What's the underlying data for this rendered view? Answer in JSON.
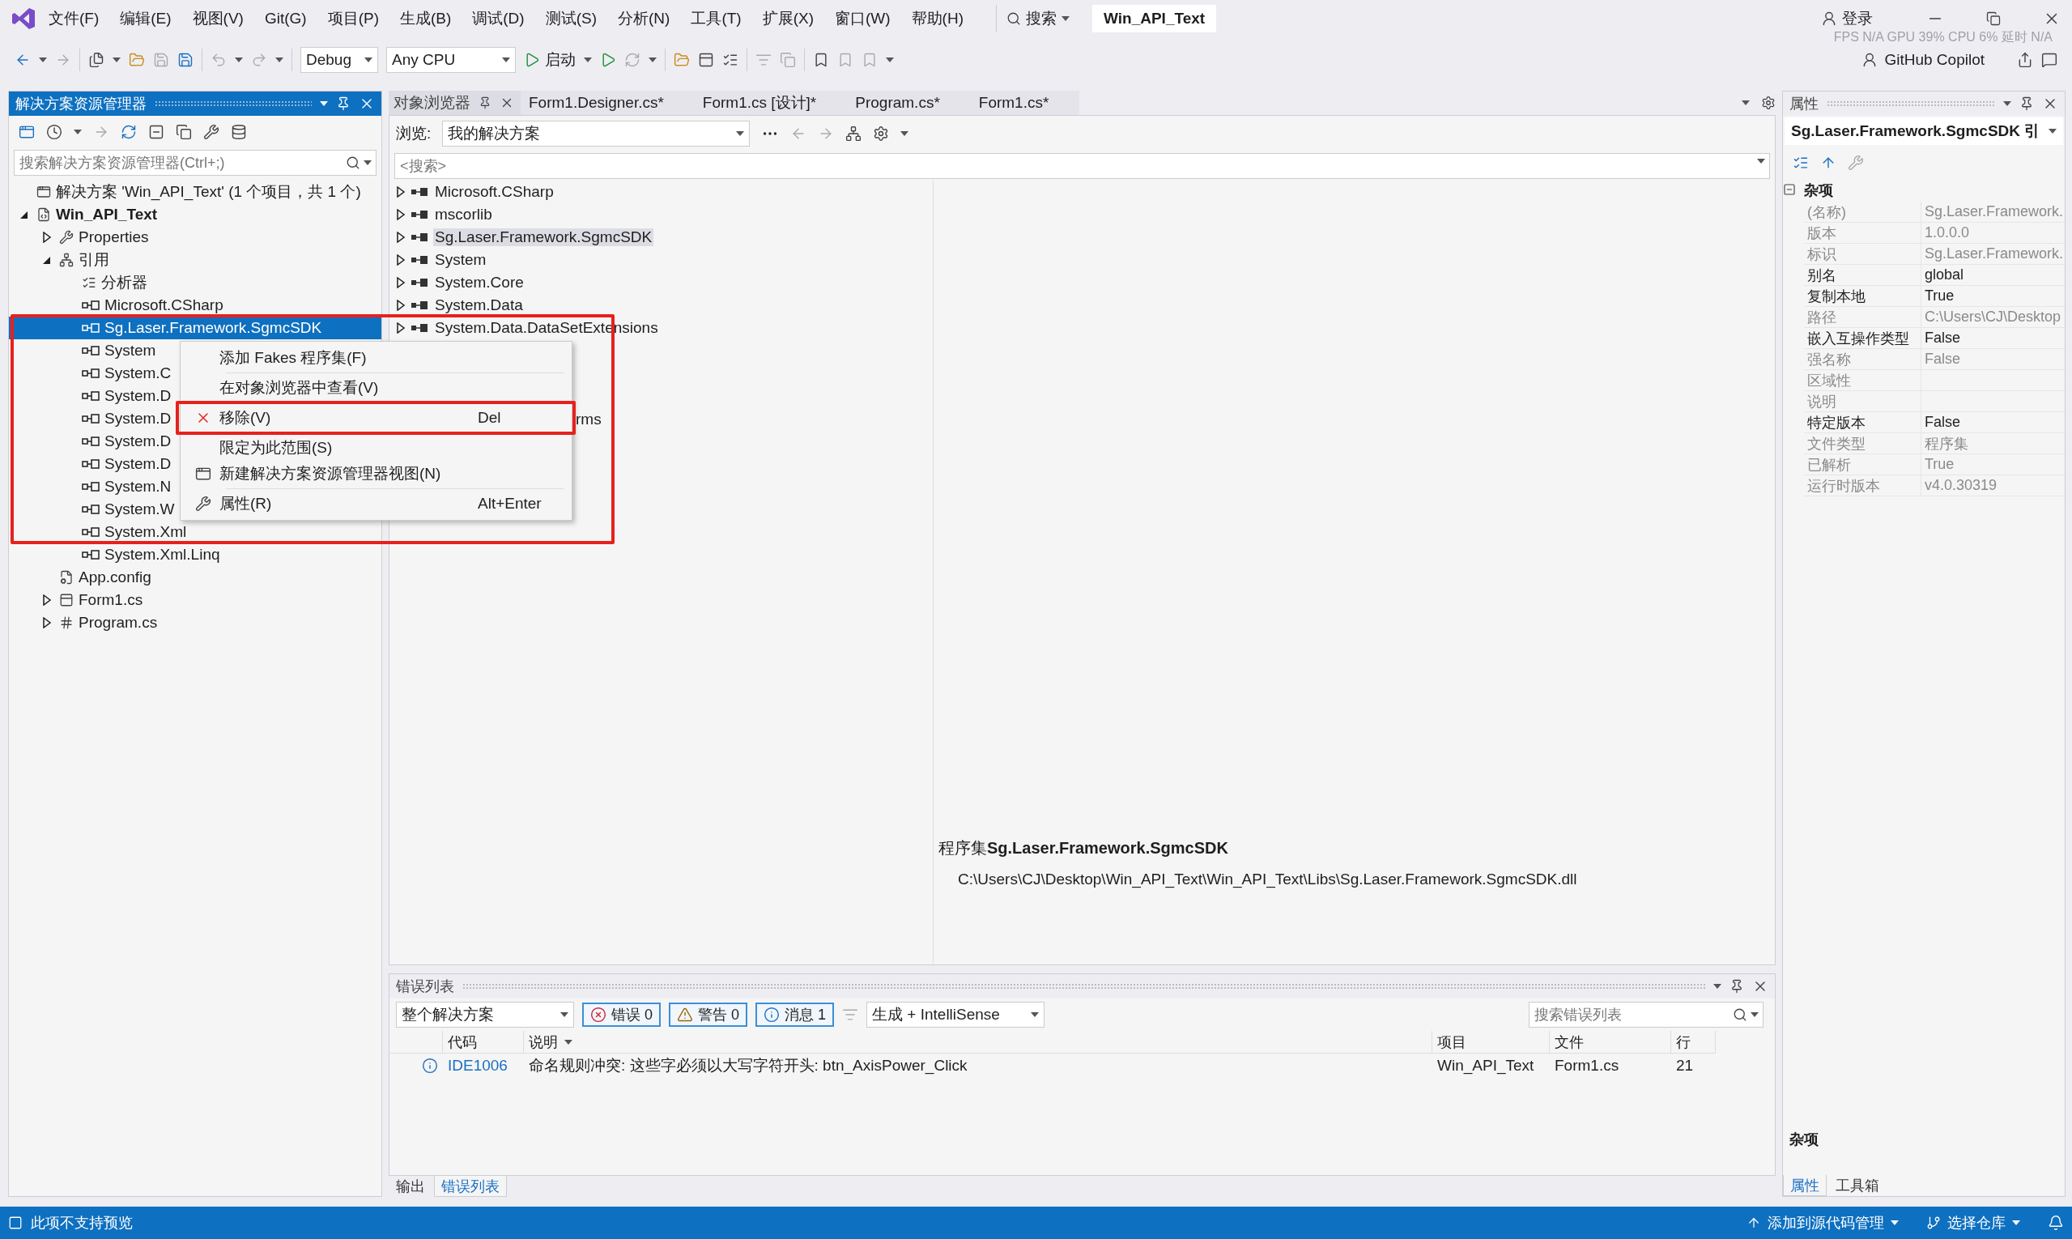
{
  "title_bar": {
    "menus": [
      "文件(F)",
      "编辑(E)",
      "视图(V)",
      "Git(G)",
      "项目(P)",
      "生成(B)",
      "调试(D)",
      "测试(S)",
      "分析(N)",
      "工具(T)",
      "扩展(X)",
      "窗口(W)",
      "帮助(H)"
    ],
    "search": "搜索",
    "solution_title": "Win_API_Text",
    "account": "登录",
    "perf_overlay": "FPS N/A GPU 39% CPU 6% 延时 N/A"
  },
  "toolbar": {
    "configuration": "Debug",
    "platform": "Any CPU",
    "start": "启动",
    "copilot": "GitHub Copilot"
  },
  "solution_explorer": {
    "title": "解决方案资源管理器",
    "search_placeholder": "搜索解决方案资源管理器(Ctrl+;)",
    "tree": [
      {
        "label": "解决方案 'Win_API_Text' (1 个项目，共 1 个)",
        "kind": "solution",
        "selected": false,
        "children": [
          {
            "label": "Win_API_Text",
            "kind": "project",
            "expanded": true,
            "selected": false,
            "children": [
              {
                "label": "Properties",
                "kind": "properties",
                "expanded": false,
                "selected": false
              },
              {
                "label": "引用",
                "kind": "references",
                "expanded": true,
                "selected": false,
                "children": [
                  {
                    "label": "分析器",
                    "kind": "analyzer",
                    "selected": false
                  },
                  {
                    "label": "Microsoft.CSharp",
                    "kind": "reference",
                    "selected": false
                  },
                  {
                    "label": "Sg.Laser.Framework.SgmcSDK",
                    "kind": "reference",
                    "selected": true
                  },
                  {
                    "label": "System",
                    "kind": "reference",
                    "selected": false
                  },
                  {
                    "label": "System.C",
                    "kind": "reference",
                    "selected": false
                  },
                  {
                    "label": "System.D",
                    "kind": "reference",
                    "selected": false
                  },
                  {
                    "label": "System.D",
                    "kind": "reference",
                    "selected": false
                  },
                  {
                    "label": "System.D",
                    "kind": "reference",
                    "selected": false
                  },
                  {
                    "label": "System.D",
                    "kind": "reference",
                    "selected": false
                  },
                  {
                    "label": "System.N",
                    "kind": "reference",
                    "selected": false
                  },
                  {
                    "label": "System.W",
                    "kind": "reference",
                    "selected": false
                  },
                  {
                    "label": "System.Xml",
                    "kind": "reference",
                    "selected": false
                  },
                  {
                    "label": "System.Xml.Linq",
                    "kind": "reference",
                    "selected": false
                  }
                ]
              },
              {
                "label": "App.config",
                "kind": "config",
                "selected": false
              },
              {
                "label": "Form1.cs",
                "kind": "form",
                "expanded": false,
                "selected": false
              },
              {
                "label": "Program.cs",
                "kind": "csharp",
                "expanded": false,
                "selected": false
              }
            ]
          }
        ]
      }
    ]
  },
  "context_menu": {
    "groups": [
      [
        {
          "label": "添加 Fakes 程序集(F)",
          "kind": "plain"
        }
      ],
      [
        {
          "label": "在对象浏览器中查看(V)",
          "kind": "plain"
        }
      ],
      [
        {
          "label": "移除(V)",
          "kind": "remove",
          "shortcut": "Del"
        }
      ],
      [
        {
          "label": "限定为此范围(S)",
          "kind": "plain"
        },
        {
          "label": "新建解决方案资源管理器视图(N)",
          "kind": "newview"
        }
      ],
      [
        {
          "label": "属性(R)",
          "kind": "properties",
          "shortcut": "Alt+Enter"
        }
      ]
    ]
  },
  "document_tabs": [
    {
      "label": "对象浏览器",
      "kind": "tool",
      "selected": true
    },
    {
      "label": "Form1.Designer.cs*",
      "kind": "document",
      "selected": false
    },
    {
      "label": "Form1.cs [设计]*",
      "kind": "document",
      "selected": false
    },
    {
      "label": "Program.cs*",
      "kind": "document",
      "selected": false
    },
    {
      "label": "Form1.cs*",
      "kind": "document",
      "selected": false
    }
  ],
  "object_browser": {
    "browse_label": "浏览:",
    "scope": "我的解决方案",
    "search_placeholder": "<搜索>",
    "items": [
      {
        "label": "Microsoft.CSharp",
        "selected": false
      },
      {
        "label": "mscorlib",
        "selected": false
      },
      {
        "label": "Sg.Laser.Framework.SgmcSDK",
        "selected": true
      },
      {
        "label": "System",
        "selected": false
      },
      {
        "label": "System.Core",
        "selected": false
      },
      {
        "label": "System.Data",
        "selected": false
      },
      {
        "label": "System.Data.DataSetExtensions",
        "selected": false
      }
    ],
    "clipped_item": "rms",
    "detail": {
      "heading": "程序集**Sg.Laser.Framework.SgmcSDK**",
      "path": "C:\\Users\\CJ\\Desktop\\Win_API_Text\\Win_API_Text\\Libs\\Sg.Laser.Framework.SgmcSDK.dll"
    }
  },
  "error_list": {
    "title": "错误列表",
    "scope": "整个解决方案",
    "filters": [
      {
        "kind": "error",
        "label": "错误 0",
        "selected": true
      },
      {
        "kind": "warning",
        "label": "警告 0",
        "selected": true
      },
      {
        "kind": "info",
        "label": "消息 1",
        "selected": true
      }
    ],
    "source": "生成 + IntelliSense",
    "search_placeholder": "搜索错误列表",
    "columns": [
      {
        "label": "代码",
        "sorted": false
      },
      {
        "label": "说明",
        "sorted": true
      },
      {
        "label": "项目",
        "sorted": false
      },
      {
        "label": "文件",
        "sorted": false
      },
      {
        "label": "行",
        "sorted": false
      }
    ],
    "rows": [
      {
        "kind": "info",
        "code": "IDE1006",
        "description": "命名规则冲突: 这些字必须以大写字符开头: btn_AxisPower_Click",
        "project": "Win_API_Text",
        "file": "Form1.cs",
        "line": "21"
      }
    ],
    "tabs": [
      {
        "label": "输出",
        "selected": false
      },
      {
        "label": "错误列表",
        "selected": true
      }
    ]
  },
  "properties": {
    "title": "属性",
    "object": "Sg.Laser.Framework.SgmcSDK 引",
    "category": "杂项",
    "rows": [
      {
        "name": "(名称)",
        "value": "Sg.Laser.Framework.",
        "readonly": true
      },
      {
        "name": "版本",
        "value": "1.0.0.0",
        "readonly": true
      },
      {
        "name": "标识",
        "value": "Sg.Laser.Framework.",
        "readonly": true
      },
      {
        "name": "别名",
        "value": "global",
        "readonly": false
      },
      {
        "name": "复制本地",
        "value": "True",
        "readonly": false
      },
      {
        "name": "路径",
        "value": "C:\\Users\\CJ\\Desktop",
        "readonly": true
      },
      {
        "name": "嵌入互操作类型",
        "value": "False",
        "readonly": false
      },
      {
        "name": "强名称",
        "value": "False",
        "readonly": true
      },
      {
        "name": "区域性",
        "readonly": true
      },
      {
        "name": "说明",
        "readonly": true
      },
      {
        "name": "特定版本",
        "value": "False",
        "readonly": false
      },
      {
        "name": "文件类型",
        "value": "程序集",
        "readonly": true
      },
      {
        "name": "已解析",
        "value": "True",
        "readonly": true
      },
      {
        "name": "运行时版本",
        "value": "v4.0.30319",
        "readonly": true
      }
    ],
    "description_title": "杂项",
    "tabs": [
      {
        "label": "属性",
        "selected": true
      },
      {
        "label": "工具箱",
        "selected": false
      }
    ]
  },
  "status_bar": {
    "message": "此项不支持预览",
    "source_control": "添加到源代码管理",
    "repository": "选择仓库"
  }
}
